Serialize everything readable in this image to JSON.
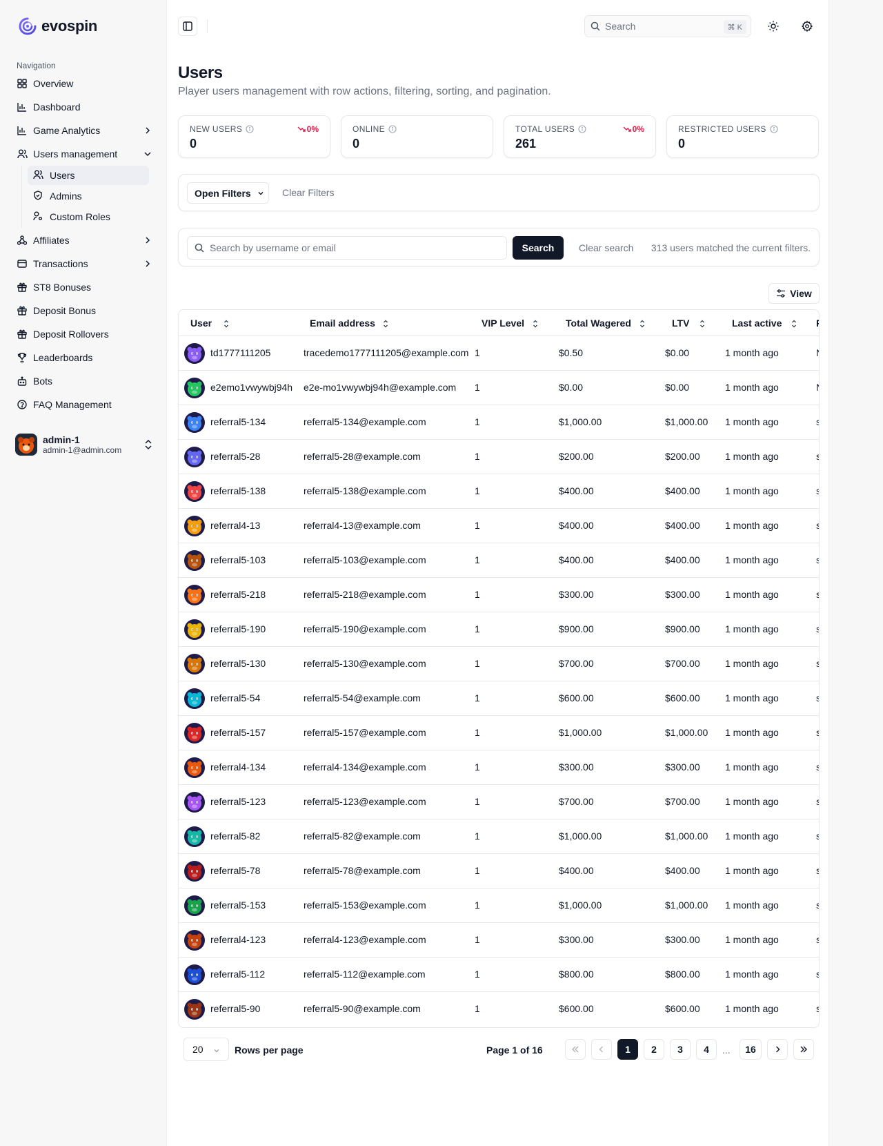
{
  "app": {
    "brand": "evospin"
  },
  "sidebar": {
    "section_title": "Navigation",
    "items": [
      {
        "label": "Overview",
        "icon": "grid-icon"
      },
      {
        "label": "Dashboard",
        "icon": "bar-chart-icon"
      },
      {
        "label": "Game Analytics",
        "icon": "bar-chart-icon"
      },
      {
        "label": "Users management",
        "icon": "users-icon"
      },
      {
        "label": "Affiliates",
        "icon": "network-icon"
      },
      {
        "label": "Transactions",
        "icon": "wallet-icon"
      },
      {
        "label": "ST8 Bonuses",
        "icon": "gift-icon"
      },
      {
        "label": "Deposit Bonus",
        "icon": "gift-icon"
      },
      {
        "label": "Deposit Rollovers",
        "icon": "gift-icon"
      },
      {
        "label": "Leaderboards",
        "icon": "trophy-icon"
      },
      {
        "label": "Bots",
        "icon": "bot-icon"
      },
      {
        "label": "FAQ Management",
        "icon": "help-circle-icon"
      }
    ],
    "sub_items": [
      {
        "label": "Users",
        "icon": "users-icon"
      },
      {
        "label": "Admins",
        "icon": "shield-icon"
      },
      {
        "label": "Custom Roles",
        "icon": "user-cog-icon"
      }
    ],
    "profile": {
      "name": "admin-1",
      "email": "admin-1@admin.com"
    }
  },
  "topbar": {
    "search_placeholder": "Search",
    "shortcut": "⌘ K"
  },
  "page": {
    "title": "Users",
    "subtitle": "Player users management with row actions, filtering, sorting, and pagination."
  },
  "stats": [
    {
      "label": "NEW USERS",
      "value": "0",
      "delta": "0%"
    },
    {
      "label": "ONLINE",
      "value": "0",
      "delta": ""
    },
    {
      "label": "TOTAL USERS",
      "value": "261",
      "delta": "0%"
    },
    {
      "label": "RESTRICTED USERS",
      "value": "0",
      "delta": ""
    }
  ],
  "filters": {
    "open_label": "Open Filters",
    "clear_label": "Clear Filters"
  },
  "search": {
    "placeholder": "Search by username or email",
    "button": "Search",
    "clear": "Clear search",
    "match_text": "313 users matched the current filters."
  },
  "view_button": "View",
  "table": {
    "columns": [
      "User",
      "Email address",
      "VIP Level",
      "Total Wagered",
      "LTV",
      "Last active"
    ],
    "rows": [
      {
        "user": "td1777111205",
        "email": "tracedemo1777111205@example.com",
        "vip": "1",
        "wagered": "$0.50",
        "ltv": "$0.00",
        "last": "1 month ago",
        "extra": "N",
        "color": "#8b5cf6"
      },
      {
        "user": "e2emo1vwywbj94h",
        "email": "e2e-mo1vwywbj94h@example.com",
        "vip": "1",
        "wagered": "$0.00",
        "ltv": "$0.00",
        "last": "1 month ago",
        "extra": "N",
        "color": "#22c55e"
      },
      {
        "user": "referral5-134",
        "email": "referral5-134@example.com",
        "vip": "1",
        "wagered": "$1,000.00",
        "ltv": "$1,000.00",
        "last": "1 month ago",
        "extra": "s",
        "color": "#3b82f6"
      },
      {
        "user": "referral5-28",
        "email": "referral5-28@example.com",
        "vip": "1",
        "wagered": "$200.00",
        "ltv": "$200.00",
        "last": "1 month ago",
        "extra": "s",
        "color": "#6366f1"
      },
      {
        "user": "referral5-138",
        "email": "referral5-138@example.com",
        "vip": "1",
        "wagered": "$400.00",
        "ltv": "$400.00",
        "last": "1 month ago",
        "extra": "s",
        "color": "#ef4444"
      },
      {
        "user": "referral4-13",
        "email": "referral4-13@example.com",
        "vip": "1",
        "wagered": "$400.00",
        "ltv": "$400.00",
        "last": "1 month ago",
        "extra": "s",
        "color": "#f59e0b"
      },
      {
        "user": "referral5-103",
        "email": "referral5-103@example.com",
        "vip": "1",
        "wagered": "$400.00",
        "ltv": "$400.00",
        "last": "1 month ago",
        "extra": "s",
        "color": "#b45309"
      },
      {
        "user": "referral5-218",
        "email": "referral5-218@example.com",
        "vip": "1",
        "wagered": "$300.00",
        "ltv": "$300.00",
        "last": "1 month ago",
        "extra": "s",
        "color": "#f97316"
      },
      {
        "user": "referral5-190",
        "email": "referral5-190@example.com",
        "vip": "1",
        "wagered": "$900.00",
        "ltv": "$900.00",
        "last": "1 month ago",
        "extra": "s",
        "color": "#eab308"
      },
      {
        "user": "referral5-130",
        "email": "referral5-130@example.com",
        "vip": "1",
        "wagered": "$700.00",
        "ltv": "$700.00",
        "last": "1 month ago",
        "extra": "s",
        "color": "#d97706"
      },
      {
        "user": "referral5-54",
        "email": "referral5-54@example.com",
        "vip": "1",
        "wagered": "$600.00",
        "ltv": "$600.00",
        "last": "1 month ago",
        "extra": "s",
        "color": "#06b6d4"
      },
      {
        "user": "referral5-157",
        "email": "referral5-157@example.com",
        "vip": "1",
        "wagered": "$1,000.00",
        "ltv": "$1,000.00",
        "last": "1 month ago",
        "extra": "s",
        "color": "#dc2626"
      },
      {
        "user": "referral4-134",
        "email": "referral4-134@example.com",
        "vip": "1",
        "wagered": "$300.00",
        "ltv": "$300.00",
        "last": "1 month ago",
        "extra": "s",
        "color": "#ea580c"
      },
      {
        "user": "referral5-123",
        "email": "referral5-123@example.com",
        "vip": "1",
        "wagered": "$700.00",
        "ltv": "$700.00",
        "last": "1 month ago",
        "extra": "s",
        "color": "#a855f7"
      },
      {
        "user": "referral5-82",
        "email": "referral5-82@example.com",
        "vip": "1",
        "wagered": "$1,000.00",
        "ltv": "$1,000.00",
        "last": "1 month ago",
        "extra": "s",
        "color": "#14b8a6"
      },
      {
        "user": "referral5-78",
        "email": "referral5-78@example.com",
        "vip": "1",
        "wagered": "$400.00",
        "ltv": "$400.00",
        "last": "1 month ago",
        "extra": "s",
        "color": "#b91c1c"
      },
      {
        "user": "referral5-153",
        "email": "referral5-153@example.com",
        "vip": "1",
        "wagered": "$1,000.00",
        "ltv": "$1,000.00",
        "last": "1 month ago",
        "extra": "s",
        "color": "#16a34a"
      },
      {
        "user": "referral4-123",
        "email": "referral4-123@example.com",
        "vip": "1",
        "wagered": "$300.00",
        "ltv": "$300.00",
        "last": "1 month ago",
        "extra": "s",
        "color": "#c2410c"
      },
      {
        "user": "referral5-112",
        "email": "referral5-112@example.com",
        "vip": "1",
        "wagered": "$800.00",
        "ltv": "$800.00",
        "last": "1 month ago",
        "extra": "s",
        "color": "#1d4ed8"
      },
      {
        "user": "referral5-90",
        "email": "referral5-90@example.com",
        "vip": "1",
        "wagered": "$600.00",
        "ltv": "$600.00",
        "last": "1 month ago",
        "extra": "s",
        "color": "#9a3412"
      }
    ]
  },
  "pagination": {
    "rows_per_page": "20",
    "rows_label": "Rows per page",
    "page_info": "Page 1 of 16",
    "pages": [
      "1",
      "2",
      "3",
      "4",
      "16"
    ],
    "ellipsis": "..."
  }
}
